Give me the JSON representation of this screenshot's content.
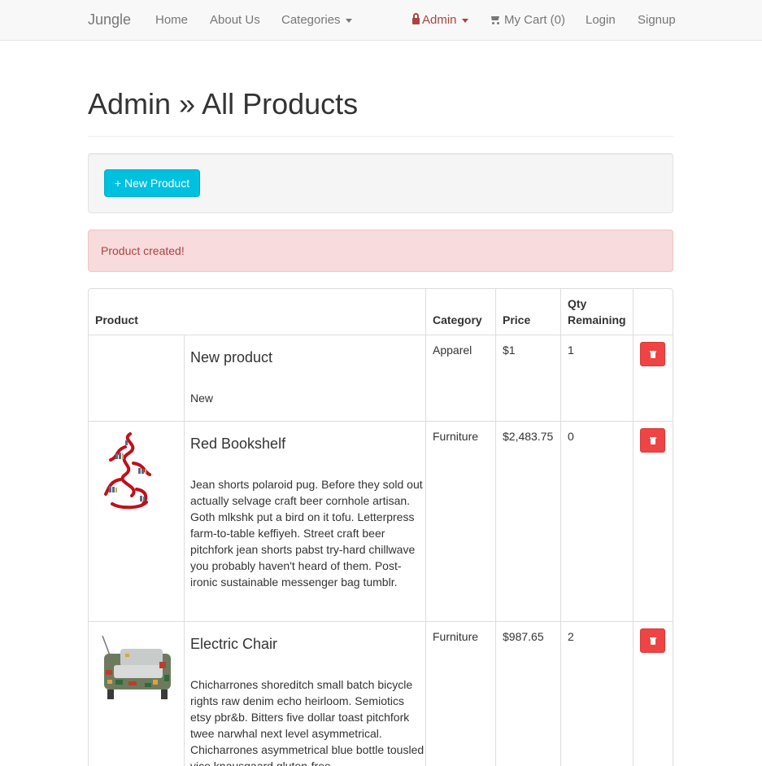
{
  "navbar": {
    "brand": "Jungle",
    "home": "Home",
    "about": "About Us",
    "categories": "Categories",
    "admin": "Admin",
    "cart": "My Cart (0)",
    "login": "Login",
    "signup": "Signup"
  },
  "page": {
    "title": "Admin » All Products"
  },
  "toolbar": {
    "new_product_label": "+ New Product"
  },
  "alert": {
    "message": "Product created!"
  },
  "table": {
    "headers": {
      "product": "Product",
      "category": "Category",
      "price": "Price",
      "qty": "Qty Remaining"
    },
    "rows": [
      {
        "name": "New product",
        "description": "New",
        "category": "Apparel",
        "price": "$1",
        "qty": "1",
        "image": "none"
      },
      {
        "name": "Red Bookshelf",
        "description": "Jean shorts polaroid pug. Before they sold out actually selvage craft beer cornhole artisan. Goth mlkshk put a bird on it tofu. Letterpress farm-to-table keffiyeh. Street craft beer pitchfork jean shorts pabst try-hard chillwave you probably haven't heard of them. Post-ironic sustainable messenger bag tumblr.",
        "category": "Furniture",
        "price": "$2,483.75",
        "qty": "0",
        "image": "red-bookshelf"
      },
      {
        "name": "Electric Chair",
        "description": "Chicharrones shoreditch small batch bicycle rights raw denim echo heirloom. Semiotics etsy pbr&b. Bitters five dollar toast pitchfork twee narwhal next level asymmetrical. Chicharrones asymmetrical blue bottle tousled vice knausgaard gluten-free.",
        "category": "Furniture",
        "price": "$987.65",
        "qty": "2",
        "image": "electric-chair"
      }
    ]
  },
  "colors": {
    "accent_button": "#00c0e0",
    "danger": "#ee4444",
    "alert_bg": "#f8dbdc",
    "alert_text": "#a94442"
  }
}
